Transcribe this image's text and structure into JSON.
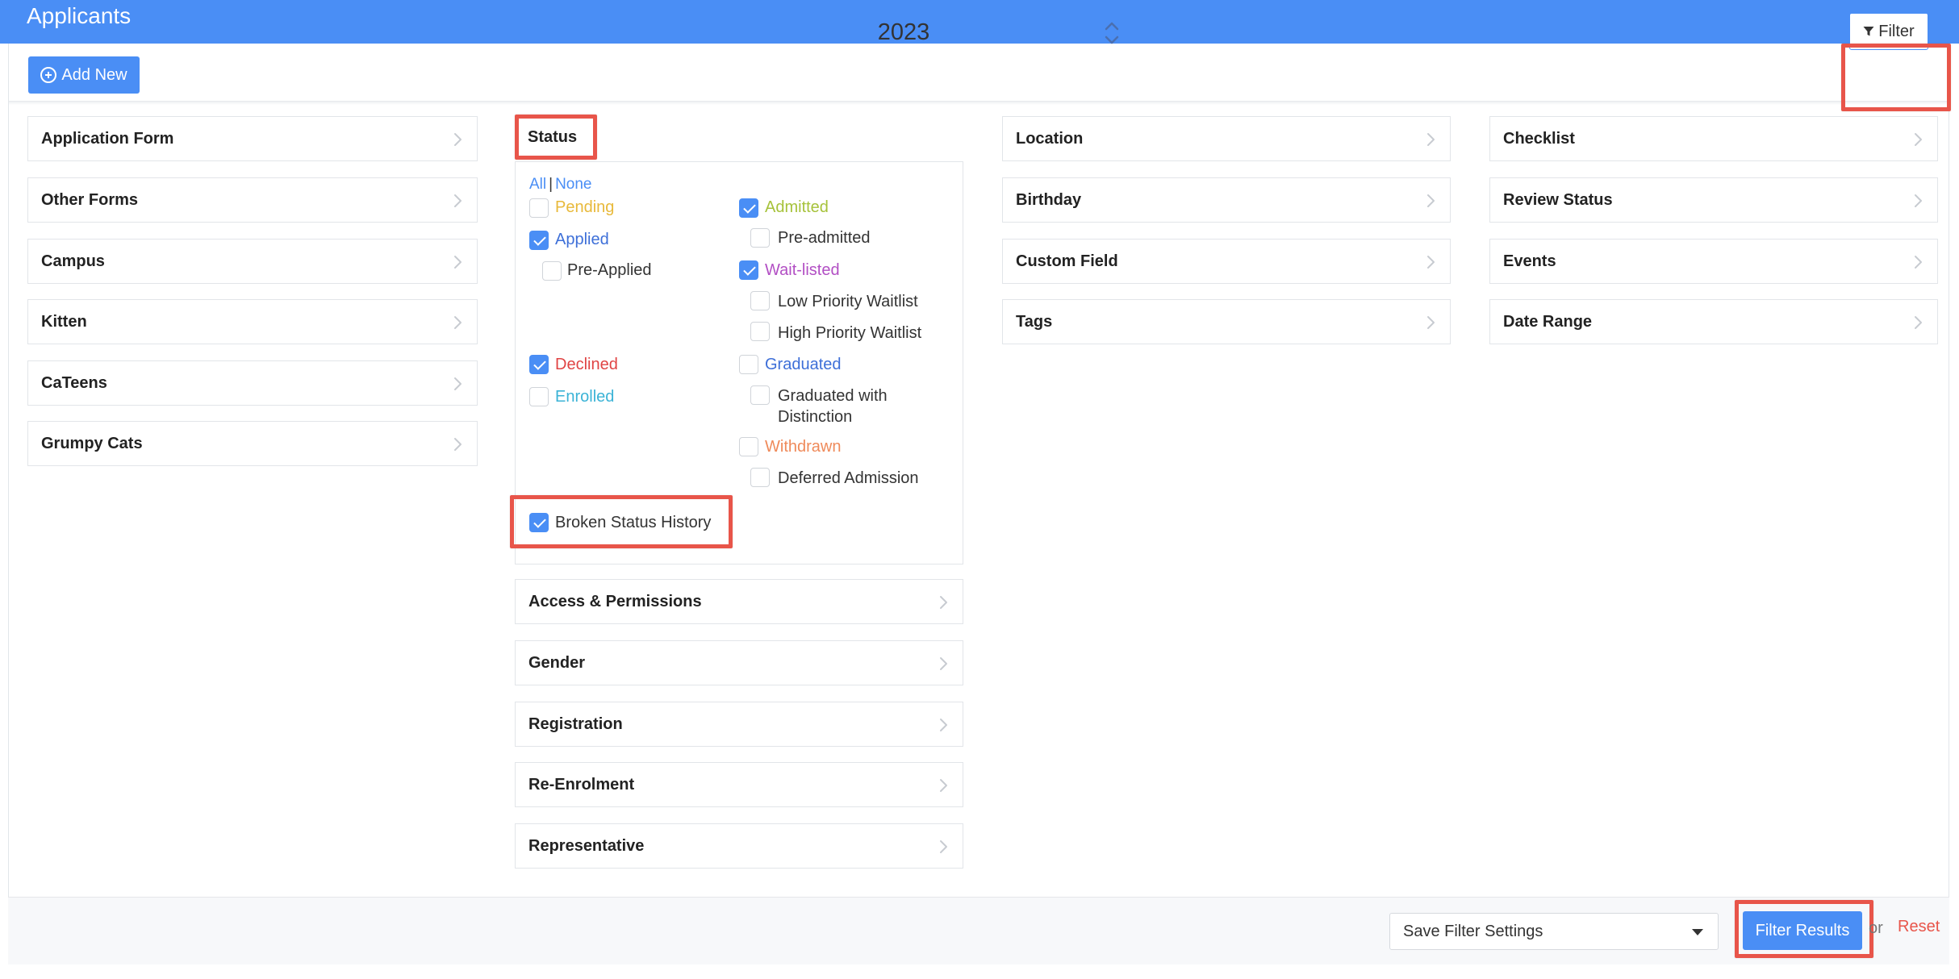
{
  "header": {
    "title": "Applicants"
  },
  "toolbar": {
    "add_new_label": "Add New",
    "year": "2023",
    "filter_label": "Filter"
  },
  "columns": {
    "col1": [
      "Application Form",
      "Other Forms",
      "Campus",
      "Kitten",
      "CaTeens",
      "Grumpy Cats"
    ],
    "col2_below": [
      "Access & Permissions",
      "Gender",
      "Registration",
      "Re-Enrolment",
      "Representative"
    ],
    "col3": [
      "Location",
      "Birthday",
      "Custom Field",
      "Tags"
    ],
    "col4": [
      "Checklist",
      "Review Status",
      "Events",
      "Date Range"
    ]
  },
  "status": {
    "title": "Status",
    "all_label": "All",
    "none_label": "None",
    "options": [
      {
        "label": "Pending",
        "checked": false,
        "color": "#e8b93a"
      },
      {
        "label": "Applied",
        "checked": true,
        "color": "#3d6fd8"
      },
      {
        "label": "Pre-Applied",
        "checked": false,
        "color": "#333333"
      },
      {
        "label": "Declined",
        "checked": true,
        "color": "#e04444"
      },
      {
        "label": "Enrolled",
        "checked": false,
        "color": "#3bb3d6"
      },
      {
        "label": "Admitted",
        "checked": true,
        "color": "#a6c23a"
      },
      {
        "label": "Pre-admitted",
        "checked": false,
        "color": "#333333"
      },
      {
        "label": "Wait-listed",
        "checked": true,
        "color": "#b24fc4"
      },
      {
        "label": "Low Priority Waitlist",
        "checked": false,
        "color": "#333333"
      },
      {
        "label": "High Priority Waitlist",
        "checked": false,
        "color": "#333333"
      },
      {
        "label": "Graduated",
        "checked": false,
        "color": "#3d6fd8"
      },
      {
        "label": "Graduated with",
        "label2": "Distinction",
        "checked": false,
        "color": "#333333"
      },
      {
        "label": "Withdrawn",
        "checked": false,
        "color": "#ef8a5a"
      },
      {
        "label": "Deferred Admission",
        "checked": false,
        "color": "#333333"
      }
    ],
    "broken_history_label": "Broken Status History",
    "broken_history_checked": true
  },
  "footer": {
    "save_select_label": "Save Filter Settings",
    "filter_results_label": "Filter Results",
    "or_label": "or",
    "reset_label": "Reset"
  },
  "colors": {
    "accent": "#4a8ef5",
    "highlight": "#e8554a",
    "reset": "#e8554a"
  }
}
